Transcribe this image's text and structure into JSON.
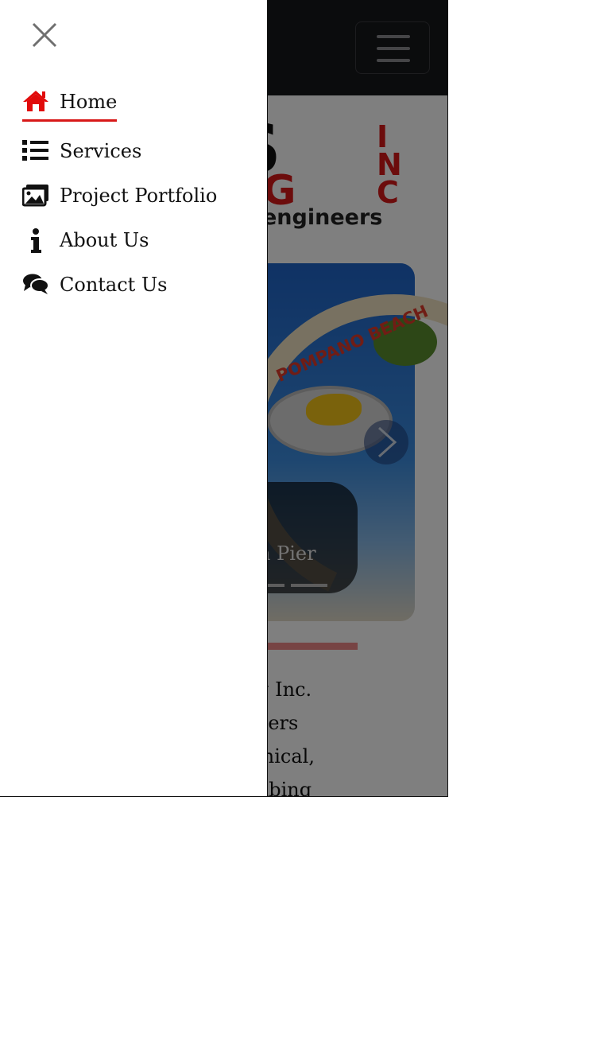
{
  "header": {
    "menu_toggle_icon": "hamburger-icon",
    "colors": {
      "bar": "#17181b"
    }
  },
  "logo": {
    "line1": "KS",
    "line2": "RING",
    "tagline": "engineers",
    "inc_letters": [
      "I",
      "N",
      "C"
    ],
    "colors": {
      "dark": "#111111",
      "accent": "#d81818"
    }
  },
  "hero": {
    "sign_text": "POMPANO BEACH",
    "caption": "n Pier",
    "next_icon": "chevron-right-icon"
  },
  "intro": {
    "lines": [
      "ing Inc.",
      "ineers",
      "hanical,",
      "umbing"
    ]
  },
  "drawer": {
    "close_icon": "close-icon",
    "items": [
      {
        "label": "Home",
        "icon": "home-icon",
        "active": true
      },
      {
        "label": "Services",
        "icon": "list-icon",
        "active": false
      },
      {
        "label": "Project Portfolio",
        "icon": "images-icon",
        "active": false
      },
      {
        "label": "About Us",
        "icon": "info-icon",
        "active": false
      },
      {
        "label": "Contact Us",
        "icon": "comments-icon",
        "active": false
      }
    ],
    "colors": {
      "active": "#e10b0b",
      "text": "#111111",
      "underline": "#d81818"
    }
  }
}
